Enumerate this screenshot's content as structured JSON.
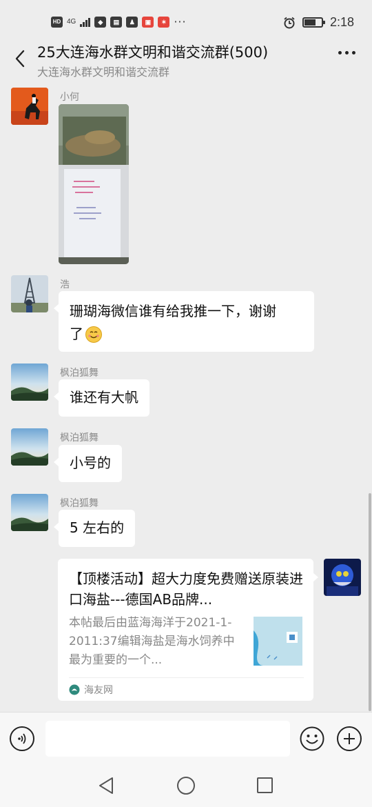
{
  "status_bar": {
    "hd": "HD",
    "network": "4G",
    "time": "2:18",
    "more": "···"
  },
  "header": {
    "title": "25大连海水群文明和谐交流群(500)",
    "subtitle": "大连海水群文明和谐交流群"
  },
  "messages": [
    {
      "sender": "小何",
      "type": "image"
    },
    {
      "sender": "浩",
      "type": "text",
      "line1": "珊瑚海微信谁有给我推一下，谢谢",
      "line2": "了"
    },
    {
      "sender": "枫泊狐舞",
      "type": "text",
      "text": "谁还有大帆"
    },
    {
      "sender": "枫泊狐舞",
      "type": "text",
      "text": "小号的"
    },
    {
      "sender": "枫泊狐舞",
      "type": "text",
      "text": "5 左右的"
    }
  ],
  "link_card": {
    "title": "【顶楼活动】超大力度免费赠送原装进口海盐---德国AB品牌...",
    "description": "本帖最后由蓝海海洋于2021-1-2011:37编辑海盐是海水饲养中最为重要的一个...",
    "source": "海友网"
  },
  "colors": {
    "background": "#ededed",
    "bubble": "#ffffff",
    "sender_name": "#8a8a8a"
  },
  "icons": [
    "back-arrow-icon",
    "more-dots-icon",
    "voice-icon",
    "emoji-icon",
    "plus-icon",
    "nav-back-icon",
    "nav-home-icon",
    "nav-recent-icon",
    "alarm-icon",
    "battery-icon"
  ]
}
